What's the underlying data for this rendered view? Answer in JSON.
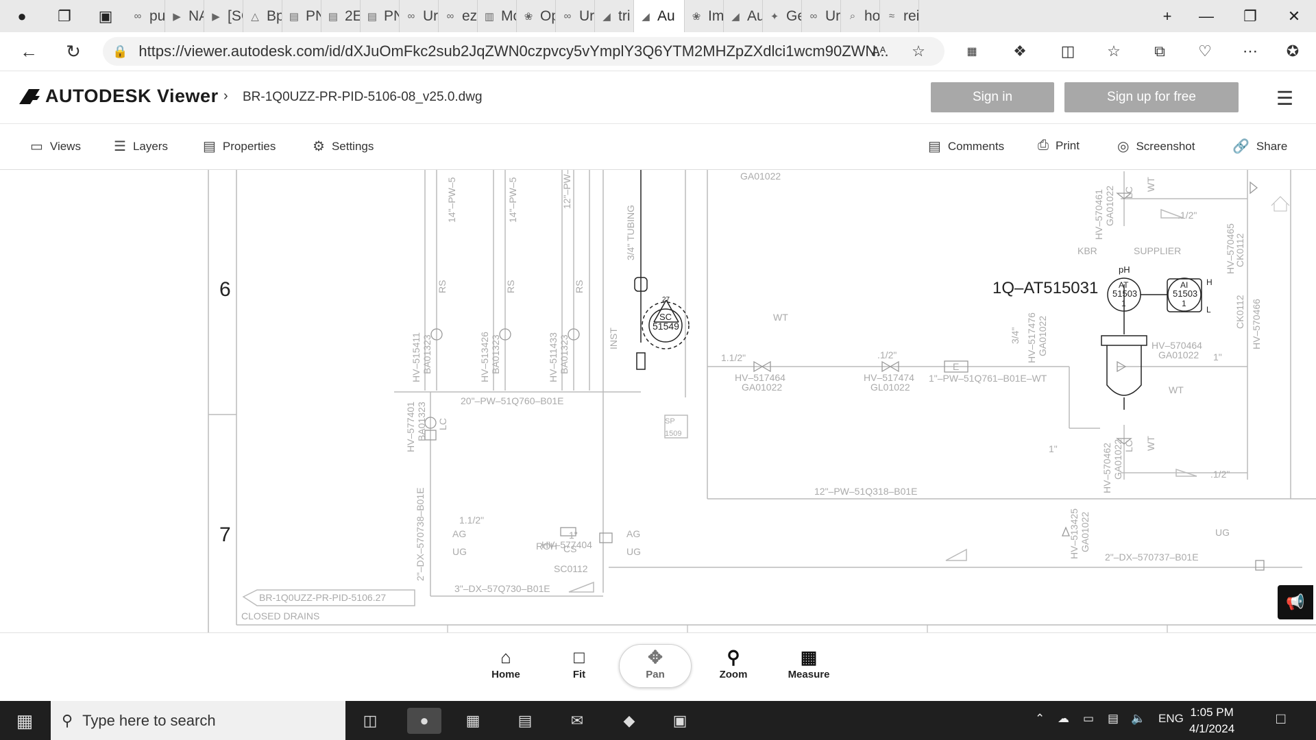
{
  "browser": {
    "tabs": [
      {
        "label": "pu",
        "icon": "link-icon"
      },
      {
        "label": "NA",
        "icon": "youtube-icon"
      },
      {
        "label": "[SC",
        "icon": "youtube-icon"
      },
      {
        "label": "Bp",
        "icon": "drive-icon"
      },
      {
        "label": "PN",
        "icon": "pdf-icon"
      },
      {
        "label": "2E",
        "icon": "pdf-icon"
      },
      {
        "label": "PN",
        "icon": "pdf-icon"
      },
      {
        "label": "Ur",
        "icon": "link-icon"
      },
      {
        "label": "ez",
        "icon": "link-icon"
      },
      {
        "label": "Mc",
        "icon": "book-icon"
      },
      {
        "label": "Op",
        "icon": "openai-icon"
      },
      {
        "label": "Ur",
        "icon": "link-icon"
      },
      {
        "label": "tri",
        "icon": "autodesk-icon"
      },
      {
        "label": "Au",
        "icon": "autodesk-icon",
        "active": true
      },
      {
        "label": "Im",
        "icon": "openai-icon"
      },
      {
        "label": "Au",
        "icon": "autodesk-icon"
      },
      {
        "label": "Ge",
        "icon": "gemini-icon"
      },
      {
        "label": "Ur",
        "icon": "link-icon"
      },
      {
        "label": "ho",
        "icon": "search-icon"
      },
      {
        "label": "rei",
        "icon": "wind-icon"
      }
    ],
    "url": "https://viewer.autodesk.com/id/dXJuOmFkc2sub2JqZWN0czpvcy5vYmplY3Q6YTM2MHZpZXdlci1wcm90ZWN...",
    "read_aloud": "Aᴬ"
  },
  "app": {
    "logo_text": "AUTODESK Viewer",
    "breadcrumb": "BR-1Q0UZZ-PR-PID-5106-08_v25.0.dwg",
    "sign_in": "Sign in",
    "sign_up": "Sign up for free"
  },
  "toolbar": {
    "views": "Views",
    "layers": "Layers",
    "properties": "Properties",
    "settings": "Settings",
    "comments": "Comments",
    "print": "Print",
    "screenshot": "Screenshot",
    "share": "Share"
  },
  "drawing": {
    "row_labels": [
      "6",
      "7"
    ],
    "texts": {
      "ga_top": "GA01022",
      "tag_at": "1Q–AT515031",
      "ph": "pH",
      "at_id": "AT",
      "at_num": "51503",
      "at_suffix": "1",
      "ai_id": "AI",
      "ai_num": "51503",
      "ai_suffix": "1",
      "h": "H",
      "l": "L",
      "sc_id": "SC",
      "sc_num": "51549",
      "tri_num": "27",
      "sp_id": "SP",
      "sp_num": "1509",
      "line_20": "20\"–PW–51Q760–B01E",
      "line_1": "1\"–PW–51Q761–B01E–WT",
      "line_12": "12\"–PW–51Q318–B01E",
      "line_2dx": "2\"–DX–570737–B01E",
      "line_3dx": "3\"–DX–57Q730–B01E",
      "line_2dx_v": "2\"–DX–570738–B01E",
      "hv515411": "HV–515411",
      "ba01323a": "BA01323",
      "hv513426": "HV–513426",
      "ba01323b": "BA01323",
      "hv511433": "HV–511433",
      "ba01323c": "BA01323",
      "hv577401": "HV–577401",
      "ba01323d": "BA01323",
      "hv517464": "HV–517464",
      "ga01022a": "GA01022",
      "hv517474": "HV–517474",
      "gl01022": "GL01022",
      "hv517476": "HV–517476",
      "ga01022b": "GA01022",
      "hv570464": "HV–570464",
      "ga01022c": "GA01022",
      "hv570461": "HV–570461",
      "ga01022d": "GA01022",
      "hv570462": "HV–570462",
      "ga01022e": "GA01022",
      "hv513425": "HV–513425",
      "ga01022f": "GA01022",
      "hv577404": "HV–577404",
      "sc0112": "SC0112",
      "hv570465": "HV–570465",
      "ck0112a": "CK0112",
      "hv570466": "HV–570466",
      "ck0112b": "CK0112",
      "offpage_ref": "BR-1Q0UZZ-PR-PID-5106.27",
      "closed_drains": "CLOSED DRAINS",
      "s11_2": "1.1/2\"",
      "s11_2b": "1.1/2\"",
      "s1_2a": ".1/2\"",
      "s1_2b": ".1/2\"",
      "s1_2c": ".1/2\"",
      "s1a": "1\"",
      "s1b": "1\"",
      "s1c": "1\"",
      "s34": "3/4\"",
      "s1d": "1\"",
      "rs": "RS",
      "wt": "WT",
      "lc": "LC",
      "roh": "ROH",
      "cs": "CS",
      "ag": "AG",
      "ug": "UG",
      "e": "E",
      "pipe14a": "14\"–PW–5",
      "pipe14b": "14\"–PW–5",
      "pipe12": "12\"–PW–",
      "tubing": "3/4\" TUBING",
      "insp": "INST",
      "kbr": "KBR",
      "supplier": "SUPPLIER"
    }
  },
  "bottom_tools": {
    "home": "Home",
    "fit": "Fit",
    "pan": "Pan",
    "zoom": "Zoom",
    "measure": "Measure"
  },
  "taskbar": {
    "search_placeholder": "Type here to search",
    "lang": "ENG",
    "time": "1:05 PM",
    "date": "4/1/2024"
  }
}
